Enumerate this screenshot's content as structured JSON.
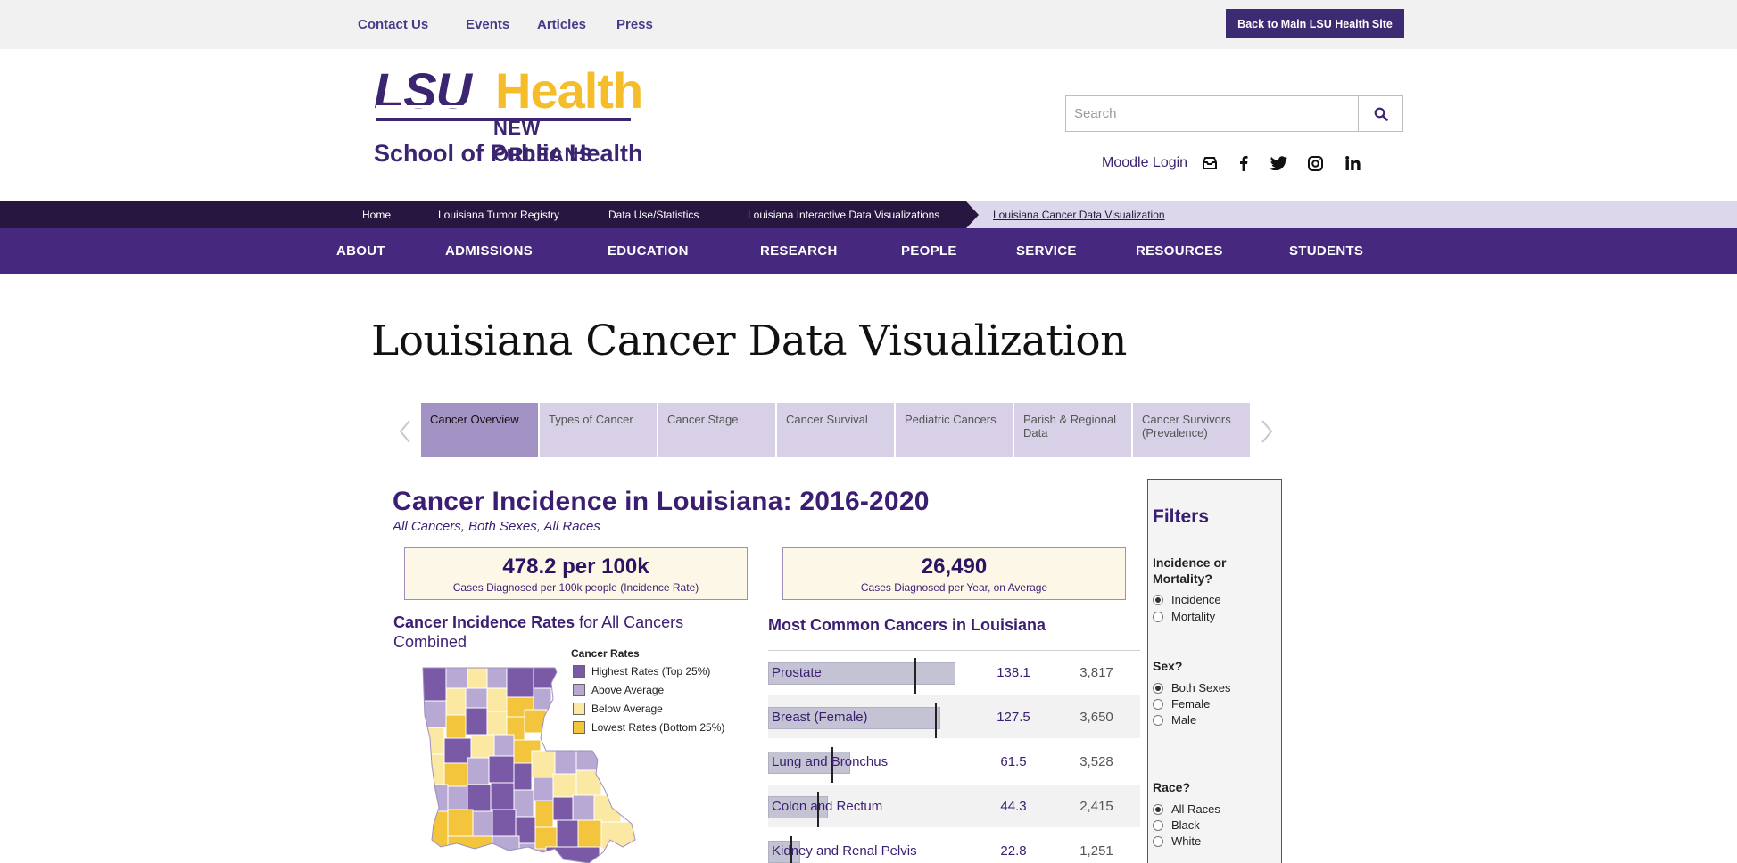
{
  "util_nav": {
    "contact": "Contact Us",
    "events": "Events",
    "articles": "Articles",
    "press": "Press",
    "back_button": "Back to Main LSU Health Site"
  },
  "logo": {
    "lsu": "LSU",
    "health": "Health",
    "new_orleans": "NEW ORLEANS",
    "school": "School of Public Health"
  },
  "search": {
    "placeholder": "Search"
  },
  "moodle": "Moodle Login",
  "breadcrumb": [
    "Home",
    "Louisiana Tumor Registry",
    "Data Use/Statistics",
    "Louisiana Interactive Data Visualizations",
    "Louisiana Cancer Data Visualization"
  ],
  "main_nav": [
    "ABOUT",
    "ADMISSIONS",
    "EDUCATION",
    "RESEARCH",
    "PEOPLE",
    "SERVICE",
    "RESOURCES",
    "STUDENTS"
  ],
  "page_title": "Louisiana Cancer Data Visualization",
  "tabs": [
    "Cancer Overview",
    "Types of Cancer",
    "Cancer Stage",
    "Cancer Survival",
    "Pediatric Cancers",
    "Parish & Regional Data",
    "Cancer Survivors (Prevalence)"
  ],
  "dashboard": {
    "title": "Cancer Incidence in Louisiana: 2016-2020",
    "subtitle": "All Cancers, Both Sexes, All Races",
    "stat1": {
      "value": "478.2 per 100k",
      "label": "Cases Diagnosed per 100k people (Incidence Rate)"
    },
    "stat2": {
      "value": "26,490",
      "label": "Cases Diagnosed per Year, on Average"
    },
    "map_title_bold": "Cancer Incidence Rates",
    "map_title_rest": " for All Cancers Combined",
    "legend_title": "Cancer Rates",
    "legend": [
      {
        "label": "Highest Rates (Top 25%)",
        "color": "#7a5aa6"
      },
      {
        "label": "Above Average",
        "color": "#b7a8d4"
      },
      {
        "label": "Below Average",
        "color": "#fbe9a3"
      },
      {
        "label": "Lowest Rates (Bottom 25%)",
        "color": "#f2c53d"
      }
    ],
    "common_title": "Most Common Cancers in Louisiana",
    "common": [
      {
        "name": "Prostate",
        "rate": "138.1",
        "count": "3,817",
        "bar": 1.0,
        "tick": 0.78
      },
      {
        "name": "Breast (Female)",
        "rate": "127.5",
        "count": "3,650",
        "bar": 0.92,
        "tick": 0.89
      },
      {
        "name": "Lung and Bronchus",
        "rate": "61.5",
        "count": "3,528",
        "bar": 0.44,
        "tick": 0.34
      },
      {
        "name": "Colon and Rectum",
        "rate": "44.3",
        "count": "2,415",
        "bar": 0.32,
        "tick": 0.26
      },
      {
        "name": "Kidney and Renal Pelvis",
        "rate": "22.8",
        "count": "1,251",
        "bar": 0.17,
        "tick": 0.12
      }
    ]
  },
  "filters": {
    "title": "Filters",
    "q1": "Incidence or Mortality?",
    "q1_options": [
      "Incidence",
      "Mortality"
    ],
    "q2": "Sex?",
    "q2_options": [
      "Both Sexes",
      "Female",
      "Male"
    ],
    "q3": "Race?",
    "q3_options": [
      "All Races",
      "Black",
      "White"
    ]
  }
}
